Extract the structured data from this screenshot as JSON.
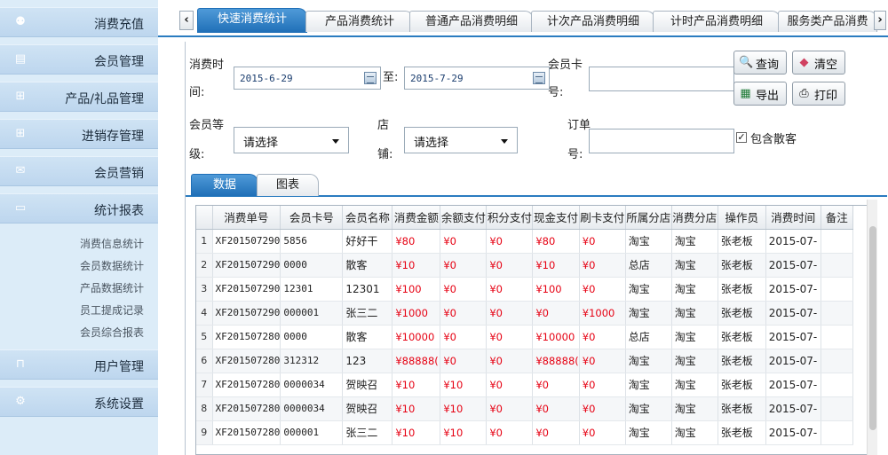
{
  "sidebar": {
    "items": [
      {
        "label": "消费充值",
        "icon": "user-icon",
        "glyph": "⚉"
      },
      {
        "label": "会员管理",
        "icon": "id-card-icon",
        "glyph": "▤"
      },
      {
        "label": "产品/礼品管理",
        "icon": "gift-icon",
        "glyph": "⊞"
      },
      {
        "label": "进销存管理",
        "icon": "gift-icon",
        "glyph": "⊞"
      },
      {
        "label": "会员营销",
        "icon": "mail-icon",
        "glyph": "✉"
      },
      {
        "label": "统计报表",
        "icon": "monitor-icon",
        "glyph": "▭"
      },
      {
        "label": "用户管理",
        "icon": "lock-icon",
        "glyph": "⊓"
      },
      {
        "label": "系统设置",
        "icon": "gear-icon",
        "glyph": "⚙"
      }
    ],
    "report_sub_items": [
      "消费信息统计",
      "会员数据统计",
      "产品数据统计",
      "员工提成记录",
      "会员综合报表"
    ]
  },
  "tabs": {
    "items": [
      "快速消费统计",
      "产品消费统计",
      "普通产品消费明细",
      "计次产品消费明细",
      "计时产品消费明细",
      "服务类产品消费"
    ],
    "active_index": 0
  },
  "filters": {
    "consume_time_label_1": "消费时",
    "consume_time_label_2": "间:",
    "start_date": "2015-6-29",
    "to_label": "至:",
    "end_date": "2015-7-29",
    "card_label_1": "会员卡",
    "card_label_2": "号:",
    "card_value": "",
    "level_label_1": "会员等",
    "level_label_2": "级:",
    "level_value": "请选择",
    "shop_label_1": "店",
    "shop_label_2": "铺:",
    "shop_value": "请选择",
    "order_label_1": "订单",
    "order_label_2": "号:",
    "order_value": "",
    "include_guest_label": "包含散客",
    "include_guest_checked": true
  },
  "buttons": {
    "query": "查询",
    "clear": "清空",
    "export": "导出",
    "print": "打印"
  },
  "subtabs": {
    "items": [
      "数据",
      "图表"
    ],
    "active_index": 0
  },
  "table": {
    "columns": [
      "消费单号",
      "会员卡号",
      "会员名称",
      "消费金额",
      "余额支付",
      "积分支付",
      "现金支付",
      "刷卡支付",
      "所属分店",
      "消费分店",
      "操作员",
      "消费时间",
      "备注"
    ],
    "rows": [
      [
        "1",
        "XF201507290",
        "5856",
        "好好干",
        "¥80",
        "¥0",
        "¥0",
        "¥80",
        "¥0",
        "淘宝",
        "淘宝",
        "张老板",
        "2015-07-",
        ""
      ],
      [
        "2",
        "XF201507290",
        "0000",
        "散客",
        "¥10",
        "¥0",
        "¥0",
        "¥10",
        "¥0",
        "总店",
        "淘宝",
        "张老板",
        "2015-07-",
        ""
      ],
      [
        "3",
        "XF201507290",
        "12301",
        "12301",
        "¥100",
        "¥0",
        "¥0",
        "¥100",
        "¥0",
        "淘宝",
        "淘宝",
        "张老板",
        "2015-07-",
        ""
      ],
      [
        "4",
        "XF201507290",
        "000001",
        "张三二",
        "¥1000",
        "¥0",
        "¥0",
        "¥0",
        "¥1000",
        "淘宝",
        "淘宝",
        "张老板",
        "2015-07-",
        ""
      ],
      [
        "5",
        "XF201507280",
        "0000",
        "散客",
        "¥10000",
        "¥0",
        "¥0",
        "¥10000",
        "¥0",
        "总店",
        "淘宝",
        "张老板",
        "2015-07-",
        ""
      ],
      [
        "6",
        "XF201507280",
        "312312",
        "123",
        "¥88888(",
        "¥0",
        "¥0",
        "¥88888(",
        "¥0",
        "淘宝",
        "淘宝",
        "张老板",
        "2015-07-",
        ""
      ],
      [
        "7",
        "XF201507280",
        "0000034",
        "贺映召",
        "¥10",
        "¥10",
        "¥0",
        "¥0",
        "¥0",
        "淘宝",
        "淘宝",
        "张老板",
        "2015-07-",
        ""
      ],
      [
        "8",
        "XF201507280",
        "0000034",
        "贺映召",
        "¥10",
        "¥10",
        "¥0",
        "¥0",
        "¥0",
        "淘宝",
        "淘宝",
        "张老板",
        "2015-07-",
        ""
      ],
      [
        "9",
        "XF201507280",
        "000001",
        "张三二",
        "¥10",
        "¥10",
        "¥0",
        "¥0",
        "¥0",
        "淘宝",
        "淘宝",
        "张老板",
        "2015-07-",
        ""
      ]
    ]
  }
}
